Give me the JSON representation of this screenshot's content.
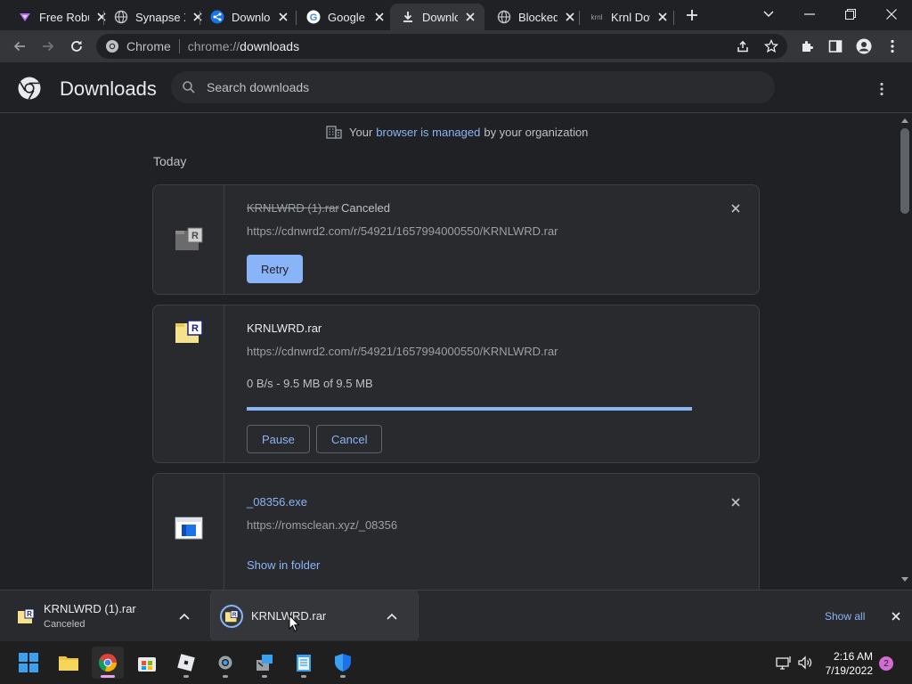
{
  "window": {
    "tabs": [
      {
        "label": "Free Robux",
        "icon": "free-robux-favicon",
        "active": false
      },
      {
        "label": "Synapse X",
        "icon": "globe-icon",
        "active": false
      },
      {
        "label": "Download",
        "icon": "share-favicon",
        "active": false
      },
      {
        "label": "Google",
        "icon": "google-icon",
        "active": false
      },
      {
        "label": "Downloads",
        "icon": "download-icon",
        "active": true
      },
      {
        "label": "Blocked",
        "icon": "globe-icon",
        "active": false
      },
      {
        "label": "Krnl Download",
        "icon": "krnl-favicon",
        "active": false
      }
    ]
  },
  "toolbar": {
    "site_label": "Chrome",
    "url_scheme": "chrome://",
    "url_path": "downloads"
  },
  "header": {
    "title": "Downloads",
    "search_placeholder": "Search downloads"
  },
  "managed": {
    "prefix": "Your",
    "link": "browser is managed",
    "suffix": "by your organization"
  },
  "section_label": "Today",
  "downloads": [
    {
      "filename": "KRNLWRD (1).rar",
      "status": "Canceled",
      "url": "https://cdnwrd2.com/r/54921/1657994000550/KRNLWRD.rar",
      "action": "Retry",
      "icon": "rar-archive-icon"
    },
    {
      "filename": "KRNLWRD.rar",
      "url": "https://cdnwrd2.com/r/54921/1657994000550/KRNLWRD.rar",
      "progress_text": "0 B/s - 9.5 MB of 9.5 MB",
      "progress": 1.0,
      "actions": [
        "Pause",
        "Cancel"
      ],
      "icon": "rar-archive-icon"
    },
    {
      "filename": "_08356.exe",
      "url": "https://romsclean.xyz/_08356",
      "action": "Show in folder",
      "icon": "exe-file-icon"
    }
  ],
  "download_bar": {
    "items": [
      {
        "name": "KRNLWRD (1).rar",
        "status": "Canceled"
      },
      {
        "name": "KRNLWRD.rar",
        "status": ""
      }
    ],
    "show_all": "Show all"
  },
  "taskbar": {
    "time": "2:16 AM",
    "date": "7/19/2022",
    "notifications": "2"
  },
  "colors": {
    "accent": "#8ab4f8",
    "background": "#202124",
    "card": "#292a2d"
  }
}
